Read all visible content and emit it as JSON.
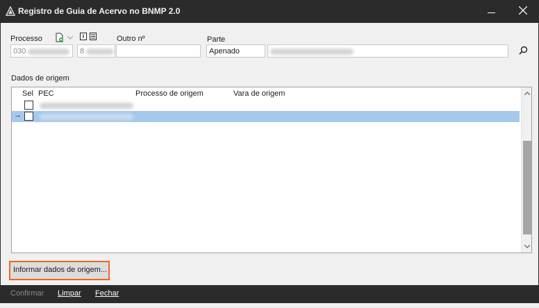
{
  "window": {
    "title": "Registro de Guia de Acervo no BNMP 2.0",
    "icon": "app-logo-icon",
    "controls": [
      "minimize-icon",
      "close-icon"
    ]
  },
  "form": {
    "processo_label": "Processo",
    "processo_value": "030",
    "processo_second_value": "8",
    "outro_label": "Outro nº",
    "outro_value": "",
    "parte_label": "Parte",
    "parte_value": "Apenado",
    "parte_name_value": ""
  },
  "grid": {
    "section_label": "Dados de origem",
    "columns": [
      "Sel",
      "PEC",
      "Processo de origem",
      "Vara de origem"
    ],
    "rows": [
      {
        "sel": false,
        "pec": "",
        "processo_origem": "",
        "vara_origem": "",
        "current": false,
        "selected": false
      },
      {
        "sel": false,
        "pec": "",
        "processo_origem": "",
        "vara_origem": "",
        "current": true,
        "selected": true
      }
    ],
    "current_row_indicator": "→"
  },
  "actions": {
    "informar_label": "Informar dados de origem..."
  },
  "footer": {
    "confirmar_label": "Confirmar",
    "limpar_label": "Limpar",
    "fechar_label": "Fechar"
  },
  "colors": {
    "chrome": "#2b2b2b",
    "client": "#f0f0f0",
    "selection": "#a5c9ec",
    "highlight_border": "#f26522",
    "scroll_thumb": "#a6a6a6"
  }
}
